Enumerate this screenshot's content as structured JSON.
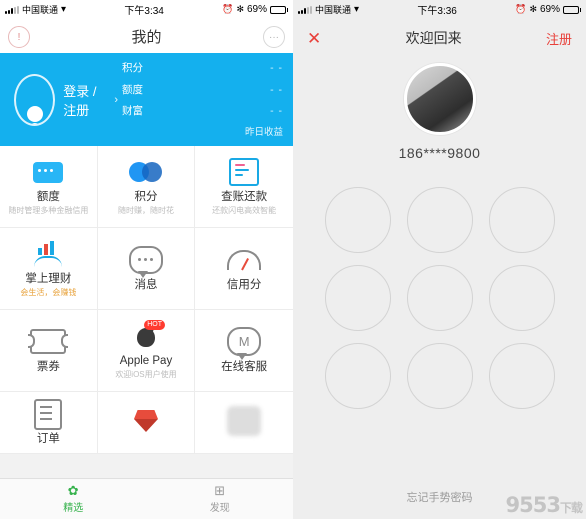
{
  "left": {
    "status": {
      "carrier": "中国联通",
      "time": "下午3:34",
      "battery": "69%",
      "battery_pct": 69
    },
    "nav": {
      "title": "我的",
      "left_icon": "alert-icon",
      "right_icon": "chat-icon"
    },
    "header": {
      "login_text": "登录 / 注册",
      "stats": [
        {
          "label": "积分",
          "value": "- -"
        },
        {
          "label": "额度",
          "value": "- -"
        },
        {
          "label": "财富",
          "value": "- -"
        }
      ],
      "footnote": "昨日收益"
    },
    "grid": [
      {
        "name": "额度",
        "sub": "随时管理多种金融信用",
        "icon": "credit-card-icon"
      },
      {
        "name": "积分",
        "sub": "随时赚，随时花",
        "icon": "points-circles-icon"
      },
      {
        "name": "查账还款",
        "sub": "还款闪电高效智能",
        "icon": "bill-icon"
      },
      {
        "name": "掌上理财",
        "sub": "会生活，会赚钱",
        "icon": "wealth-hand-icon",
        "sub_orange": true
      },
      {
        "name": "消息",
        "sub": "",
        "icon": "message-icon"
      },
      {
        "name": "信用分",
        "sub": "",
        "icon": "credit-score-icon"
      },
      {
        "name": "票券",
        "sub": "",
        "icon": "ticket-icon"
      },
      {
        "name": "Apple Pay",
        "sub": "欢迎iOS用户使用",
        "icon": "apple-pay-icon",
        "badge": "HOT"
      },
      {
        "name": "在线客服",
        "sub": "",
        "icon": "customer-service-icon"
      },
      {
        "name": "订单",
        "sub": "",
        "icon": "order-list-icon"
      },
      {
        "name": "",
        "sub": "",
        "icon": "diamond-icon"
      },
      {
        "name": "",
        "sub": "",
        "icon": "blurred-icon"
      }
    ],
    "tabs": [
      {
        "label": "精选",
        "icon": "star-icon",
        "active": true
      },
      {
        "label": "发现",
        "icon": "compass-icon",
        "active": false
      }
    ]
  },
  "right": {
    "status": {
      "carrier": "中国联通",
      "time": "下午3:36",
      "battery": "69%",
      "battery_pct": 69
    },
    "nav": {
      "close": "✕",
      "title": "欢迎回来",
      "register": "注册"
    },
    "phone": "186****9800",
    "avatar": "user-photo",
    "pattern_dots": 9,
    "forgot": "忘记手势密码"
  },
  "watermark": {
    "text": "9553",
    "suffix": "下载"
  },
  "colors": {
    "accent": "#14b0ee",
    "red": "#e8403a",
    "green": "#37b24d"
  }
}
